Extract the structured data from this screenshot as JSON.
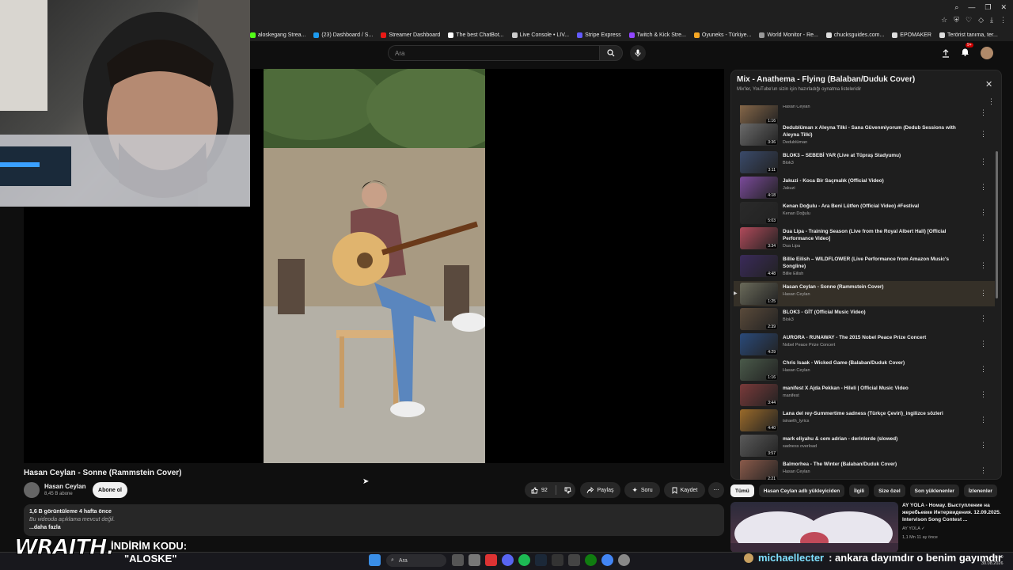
{
  "browser": {
    "bookmarks": [
      {
        "label": "aloskegang Strea...",
        "color": "#53fc18"
      },
      {
        "label": "(23) Dashboard / S...",
        "color": "#1d9bf0"
      },
      {
        "label": "Streamer Dashboard",
        "color": "#e91916"
      },
      {
        "label": "The best ChatBot...",
        "color": "#ffffff"
      },
      {
        "label": "Live Console • LIV...",
        "color": "#cccccc"
      },
      {
        "label": "Stripe Express",
        "color": "#635bff"
      },
      {
        "label": "Twitch & Kick Stre...",
        "color": "#9146ff"
      },
      {
        "label": "Oyuneks - Türkiye...",
        "color": "#f5a623"
      },
      {
        "label": "World Monitor - Re...",
        "color": "#999999"
      },
      {
        "label": "chucksguides.com...",
        "color": "#dddddd"
      },
      {
        "label": "EPOMAKER",
        "color": "#dddddd"
      },
      {
        "label": "Terörist tanıma, ter...",
        "color": "#dddddd"
      }
    ]
  },
  "youtube": {
    "search_placeholder": "Ara",
    "notifications_badge": "9+",
    "video": {
      "title": "Hasan Ceylan - Sonne (Rammstein Cover)",
      "channel": "Hasan Ceylan",
      "subscribers": "8,45 B abone",
      "subscribe_label": "Abone ol",
      "likes": "92",
      "share_label": "Paylaş",
      "ask_label": "Soru",
      "save_label": "Kaydet",
      "views_line": "1,6 B görüntüleme  4 hafta önce",
      "no_description": "Bu videoda açıklama mevcut değil.",
      "more_label": "...daha fazla"
    },
    "playlist": {
      "title": "Mix - Anathema - Flying (Balaban/Duduk Cover)",
      "subtitle": "Mix'ler, YouTube'un sizin için hazırladığı oynatma listeleridir",
      "items": [
        {
          "title": "",
          "channel": "Hasan Ceylan",
          "duration": "1:16",
          "color": "#8a6a4a",
          "active": false
        },
        {
          "title": "Dedublüman x Aleyna Tilki - Sana Güvenmiyorum (Dedub Sessions with Aleyna Tilki)",
          "channel": "Dedublüman",
          "duration": "3:36",
          "color": "#6a6a6a",
          "active": false
        },
        {
          "title": "BLOK3 – SEBEBİ YAR (Live at Tüpraş Stadyumu)",
          "channel": "Blok3",
          "duration": "3:11",
          "color": "#3a4a6a",
          "active": false
        },
        {
          "title": "Jakuzi - Koca Bir Saçmalık (Official Video)",
          "channel": "Jakuzi",
          "duration": "4:18",
          "color": "#7a4a9a",
          "active": false
        },
        {
          "title": "Kenan Doğulu - Ara Beni Lütfen (Official Video) #Festival",
          "channel": "Kenan Doğulu",
          "duration": "5:03",
          "color": "#2a2a2a",
          "active": false
        },
        {
          "title": "Dua Lipa - Training Season (Live from the Royal Albert Hall) [Official Performance Video]",
          "channel": "Dua Lipa",
          "duration": "3:34",
          "color": "#b04a5a",
          "active": false
        },
        {
          "title": "Billie Eilish – WILDFLOWER (Live Performance from Amazon Music's Songline)",
          "channel": "Billie Eilish",
          "duration": "4:48",
          "color": "#3a2a5a",
          "active": false
        },
        {
          "title": "Hasan Ceylan - Sonne (Rammstein Cover)",
          "channel": "Hasan Ceylan",
          "duration": "1:25",
          "color": "#6a6a5a",
          "active": true
        },
        {
          "title": "BLOK3 - GİT (Official Music Video)",
          "channel": "Blok3",
          "duration": "2:39",
          "color": "#5a4a3a",
          "active": false
        },
        {
          "title": "AURORA - RUNAWAY - The 2015 Nobel Peace Prize Concert",
          "channel": "Nobel Peace Prize Concert",
          "duration": "4:29",
          "color": "#2a4a7a",
          "active": false
        },
        {
          "title": "Chris Isaak - Wicked Game (Balaban/Duduk Cover)",
          "channel": "Hasan Ceylan",
          "duration": "1:16",
          "color": "#4a5a4a",
          "active": false
        },
        {
          "title": "manifest X Ajda Pekkan - Hileli | Official Music Video",
          "channel": "manifest",
          "duration": "3:44",
          "color": "#7a3a3a",
          "active": false
        },
        {
          "title": "Lana del rey-Summertime sadness (Türkçe Çeviri)_ingilizce sözleri",
          "channel": "isiraeth_lyrics",
          "duration": "4:40",
          "color": "#9a6a2a",
          "active": false
        },
        {
          "title": "mark eliyahu & cem adrian - derinlerde (slowed)",
          "channel": "sadness overload",
          "duration": "3:57",
          "color": "#5a5a5a",
          "active": false
        },
        {
          "title": "Balmorhea - The Winter (Balaban/Duduk Cover)",
          "channel": "Hasan Ceylan",
          "duration": "2:21",
          "color": "#8a5a4a",
          "active": false
        }
      ]
    },
    "chips": [
      "Tümü",
      "Hasan Ceylan adlı yükleyiciden",
      "İlgili",
      "Size özel",
      "Son yüklenenler",
      "İzlenenler"
    ],
    "recommended": {
      "title": "AY YOLA - Hoмay. Выступление на жеребьевке Интервидения. 12.09.2025. Intervison Song Contest ...",
      "channel": "AY YOLA",
      "views": "1,1 Mn",
      "age": "11 ay önce"
    }
  },
  "stream_overlay": {
    "sponsor": "WRAITH.",
    "promo_label": "İNDİRİM KODU:",
    "promo_code": "\"ALOSKE\"",
    "chat_user": "michaellecter",
    "chat_message": ": ankara dayımdır o benim gayımdır"
  },
  "taskbar": {
    "search_placeholder": "Ara",
    "time": "18:10",
    "date": "30.08.2026"
  }
}
